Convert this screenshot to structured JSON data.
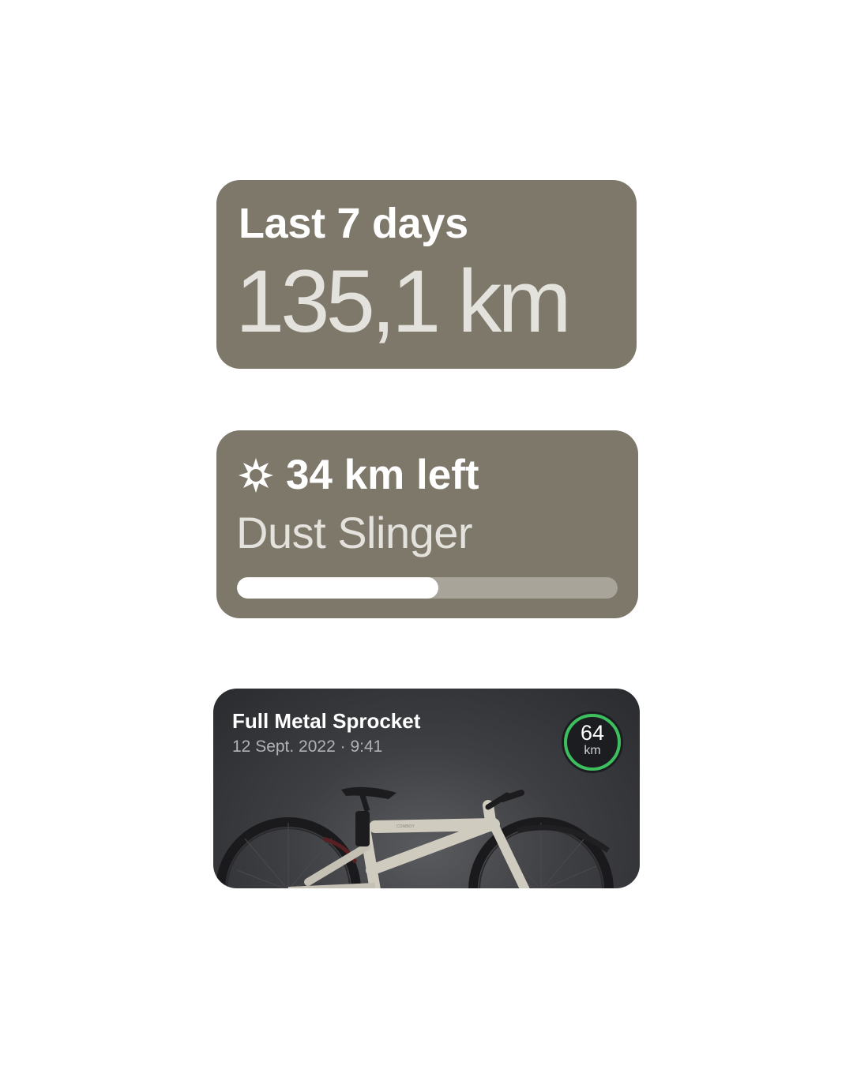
{
  "weekly": {
    "label": "Last 7 days",
    "value": "135,1 km"
  },
  "badge": {
    "icon": "badge-star-icon",
    "remaining": "34 km left",
    "name": "Dust Slinger",
    "progress_fraction": 0.53
  },
  "ride": {
    "bike_name": "Full Metal Sprocket",
    "datetime": "12 Sept. 2022 · 9:41",
    "distance_value": "64",
    "distance_unit": "km",
    "ring_color": "#3dbf5e",
    "frame_brand": "COWBOY"
  },
  "colors": {
    "widget_bg": "#7e786a",
    "ride_bg": "#2f3034",
    "progress_fill": "#ffffff",
    "progress_track": "#a8a49a"
  }
}
